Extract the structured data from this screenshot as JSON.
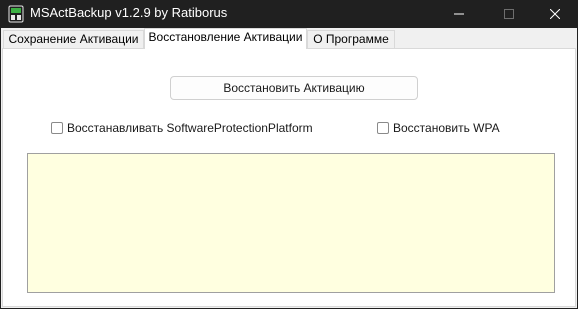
{
  "window": {
    "title": "MSActBackup v1.2.9 by Ratiborus",
    "icon": "app-icon",
    "controls": {
      "minimize_icon": "minimize-icon",
      "maximize_icon": "maximize-icon",
      "close_icon": "close-icon"
    }
  },
  "tabs": [
    {
      "label": "Сохранение Активации",
      "selected": false
    },
    {
      "label": "Восстановление Активации",
      "selected": true
    },
    {
      "label": "О Программе",
      "selected": false
    }
  ],
  "panel": {
    "restore_button": "Восстановить Активацию",
    "checkboxes": [
      {
        "label": "Восстанавливать SoftwareProtectionPlatform",
        "checked": false
      },
      {
        "label": "Восстановить WPA",
        "checked": false
      }
    ],
    "output_text": ""
  },
  "colors": {
    "titlebar": "#202020",
    "client": "#f0f0f0",
    "panel": "#ffffff",
    "output_background": "#ffffe0"
  }
}
